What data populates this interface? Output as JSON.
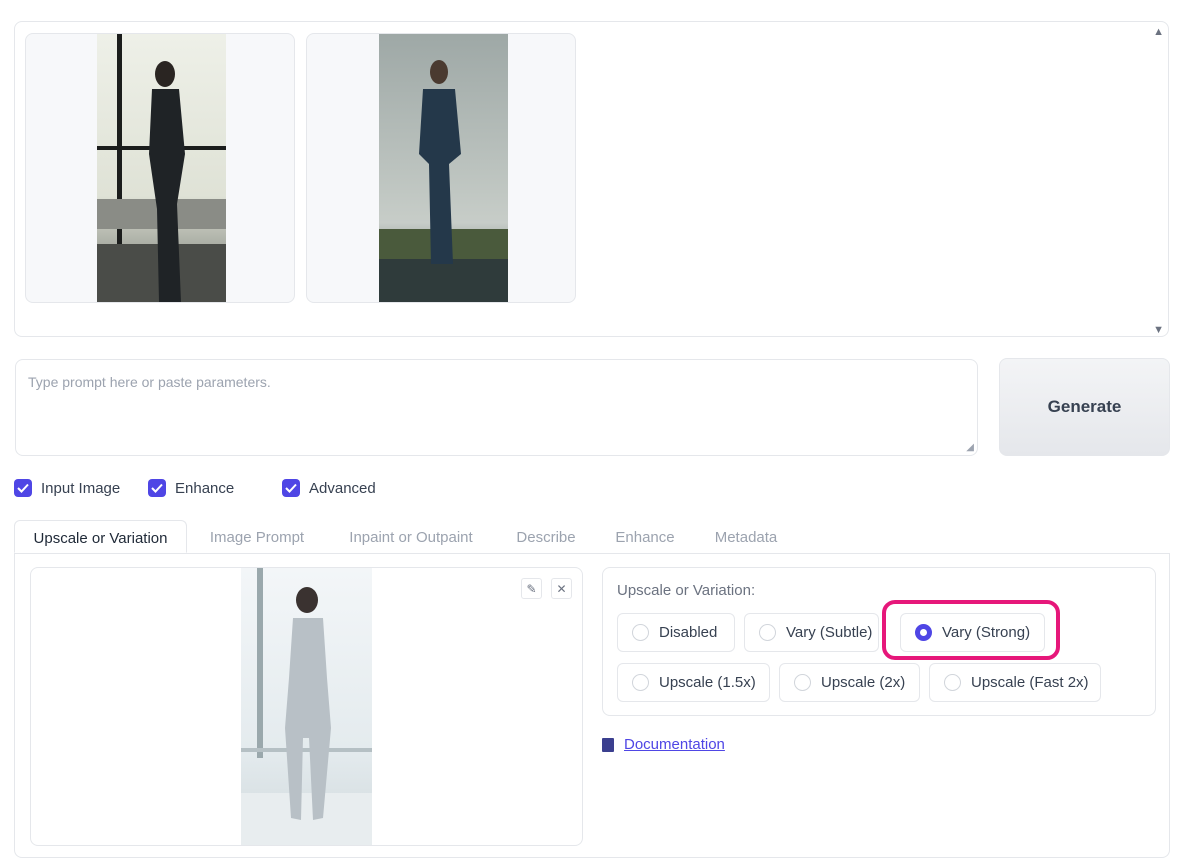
{
  "gallery": {
    "thumbnails": [
      {
        "name": "woman-silhouette-window"
      },
      {
        "name": "woman-standing-lake"
      }
    ]
  },
  "prompt": {
    "placeholder": "Type prompt here or paste parameters."
  },
  "generate_label": "Generate",
  "checkboxes": [
    {
      "label": "Input Image",
      "checked": true
    },
    {
      "label": "Enhance",
      "checked": true
    },
    {
      "label": "Advanced",
      "checked": true
    }
  ],
  "tabs": [
    {
      "label": "Upscale or Variation",
      "active": true
    },
    {
      "label": "Image Prompt",
      "active": false
    },
    {
      "label": "Inpaint or Outpaint",
      "active": false
    },
    {
      "label": "Describe",
      "active": false
    },
    {
      "label": "Enhance",
      "active": false
    },
    {
      "label": "Metadata",
      "active": false
    }
  ],
  "upscale": {
    "title": "Upscale or Variation:",
    "options": [
      "Disabled",
      "Vary (Subtle)",
      "Vary (Strong)",
      "Upscale (1.5x)",
      "Upscale (2x)",
      "Upscale (Fast 2x)"
    ],
    "selected": "Vary (Strong)"
  },
  "documentation_label": "Documentation",
  "colors": {
    "accent": "#4f46e5",
    "highlight": "#e6177a"
  }
}
